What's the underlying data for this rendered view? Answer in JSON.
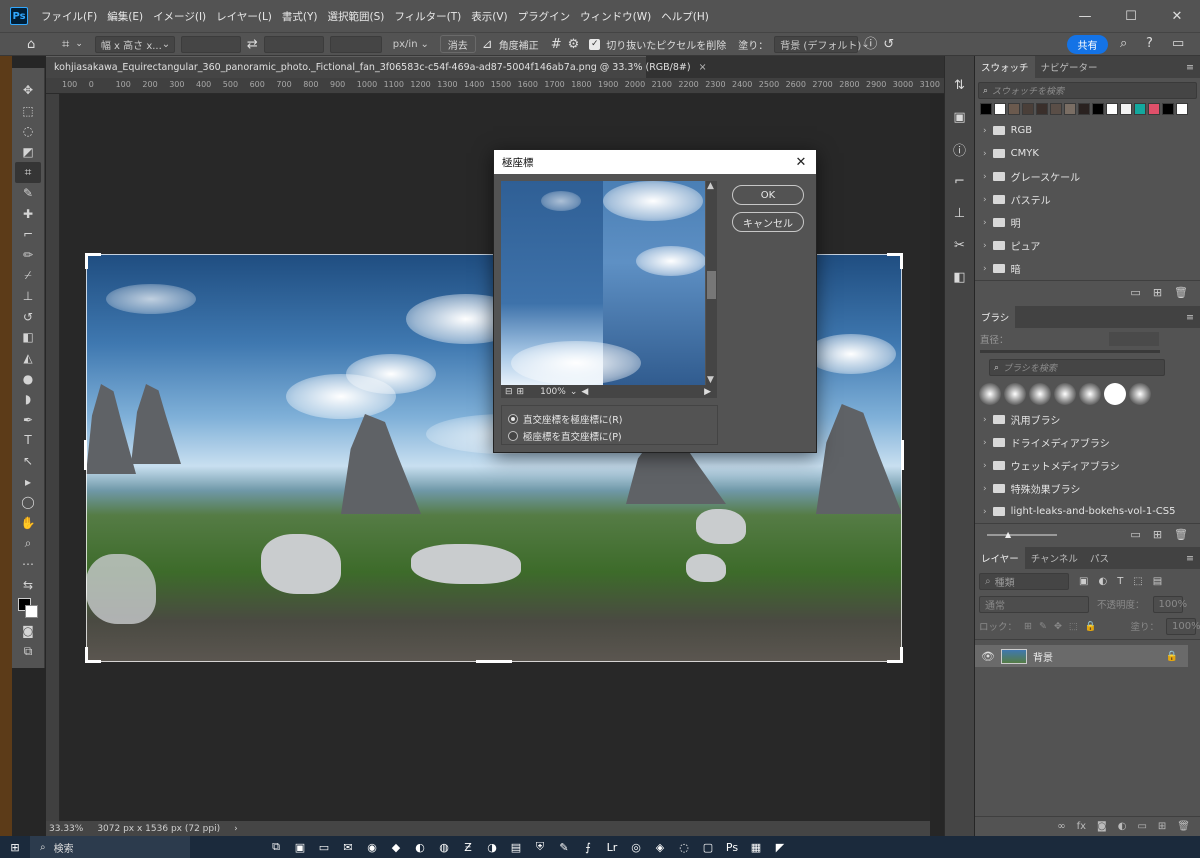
{
  "app": {
    "logo": "Ps"
  },
  "menu": [
    "ファイル(F)",
    "編集(E)",
    "イメージ(I)",
    "レイヤー(L)",
    "書式(Y)",
    "選択範囲(S)",
    "フィルター(T)",
    "表示(V)",
    "プラグイン",
    "ウィンドウ(W)",
    "ヘルプ(H)"
  ],
  "window_controls": {
    "minimize": "—",
    "maximize": "☐",
    "close": "✕"
  },
  "options": {
    "ratio_select": "幅 x 高さ x...",
    "unit_select": "px/in",
    "clear_button": "消去",
    "straighten_label": "角度補正",
    "delete_cropped_label": "切り抜いたピクセルを削除",
    "fill_label": "塗り：",
    "fill_select": "背景 (デフォルト)",
    "share_button": "共有"
  },
  "document": {
    "tab_title": "kohjiasakawa_Equirectangular_360_panoramic_photo._Fictional_fan_3f06583c-c54f-469a-ad87-5004f146ab7a.png @ 33.3% (RGB/8#)",
    "tab_close": "×",
    "zoom": "33.33%",
    "size_info": "3072 px x 1536 px (72 ppi)",
    "status_arrow": "›"
  },
  "ruler_labels": [
    "100",
    "0",
    "100",
    "200",
    "300",
    "400",
    "500",
    "600",
    "700",
    "800",
    "900",
    "1000",
    "1100",
    "1200",
    "1300",
    "1400",
    "1500",
    "1600",
    "1700",
    "1800",
    "1900",
    "2000",
    "2100",
    "2200",
    "2300",
    "2400",
    "2500",
    "2600",
    "2700",
    "2800",
    "2900",
    "3000",
    "3100"
  ],
  "dialog": {
    "title": "極座標",
    "close": "✕",
    "ok": "OK",
    "cancel": "キャンセル",
    "zoom": "100%",
    "options": [
      {
        "label": "直交座標を極座標に(R)",
        "selected": true
      },
      {
        "label": "極座標を直交座標に(P)",
        "selected": false
      }
    ]
  },
  "swatches_panel": {
    "tabs": [
      "スウォッチ",
      "ナビゲーター"
    ],
    "search_placeholder": "スウォッチを検索",
    "colors": [
      "#000000",
      "#ffffff",
      "#6b5a4e",
      "#4a3f39",
      "#3a2f2b",
      "#5a4e47",
      "#7a6e64",
      "#2a2220",
      "#000000",
      "#ffffff",
      "#f2f2f2",
      "#13a89e",
      "#e0506a",
      "#000000",
      "#ffffff"
    ],
    "groups": [
      "RGB",
      "CMYK",
      "グレースケール",
      "パステル",
      "明",
      "ピュア",
      "暗"
    ]
  },
  "brush_panel": {
    "tab": "ブラシ",
    "size_label": "直径：",
    "search_placeholder": "ブラシを検索",
    "groups": [
      "汎用ブラシ",
      "ドライメディアブラシ",
      "ウェットメディアブラシ",
      "特殊効果ブラシ",
      "light-leaks-and-bokehs-vol-1-CS5"
    ]
  },
  "layers_panel": {
    "tabs": [
      "レイヤー",
      "チャンネル",
      "パス"
    ],
    "kind_placeholder": "種類",
    "blend_mode": "通常",
    "opacity_label": "不透明度：",
    "opacity_value": "100%",
    "lock_label": "ロック：",
    "fill_label": "塗り：",
    "fill_value": "100%",
    "layer_name": "背景"
  },
  "taskbar": {
    "search_label": "検索"
  }
}
